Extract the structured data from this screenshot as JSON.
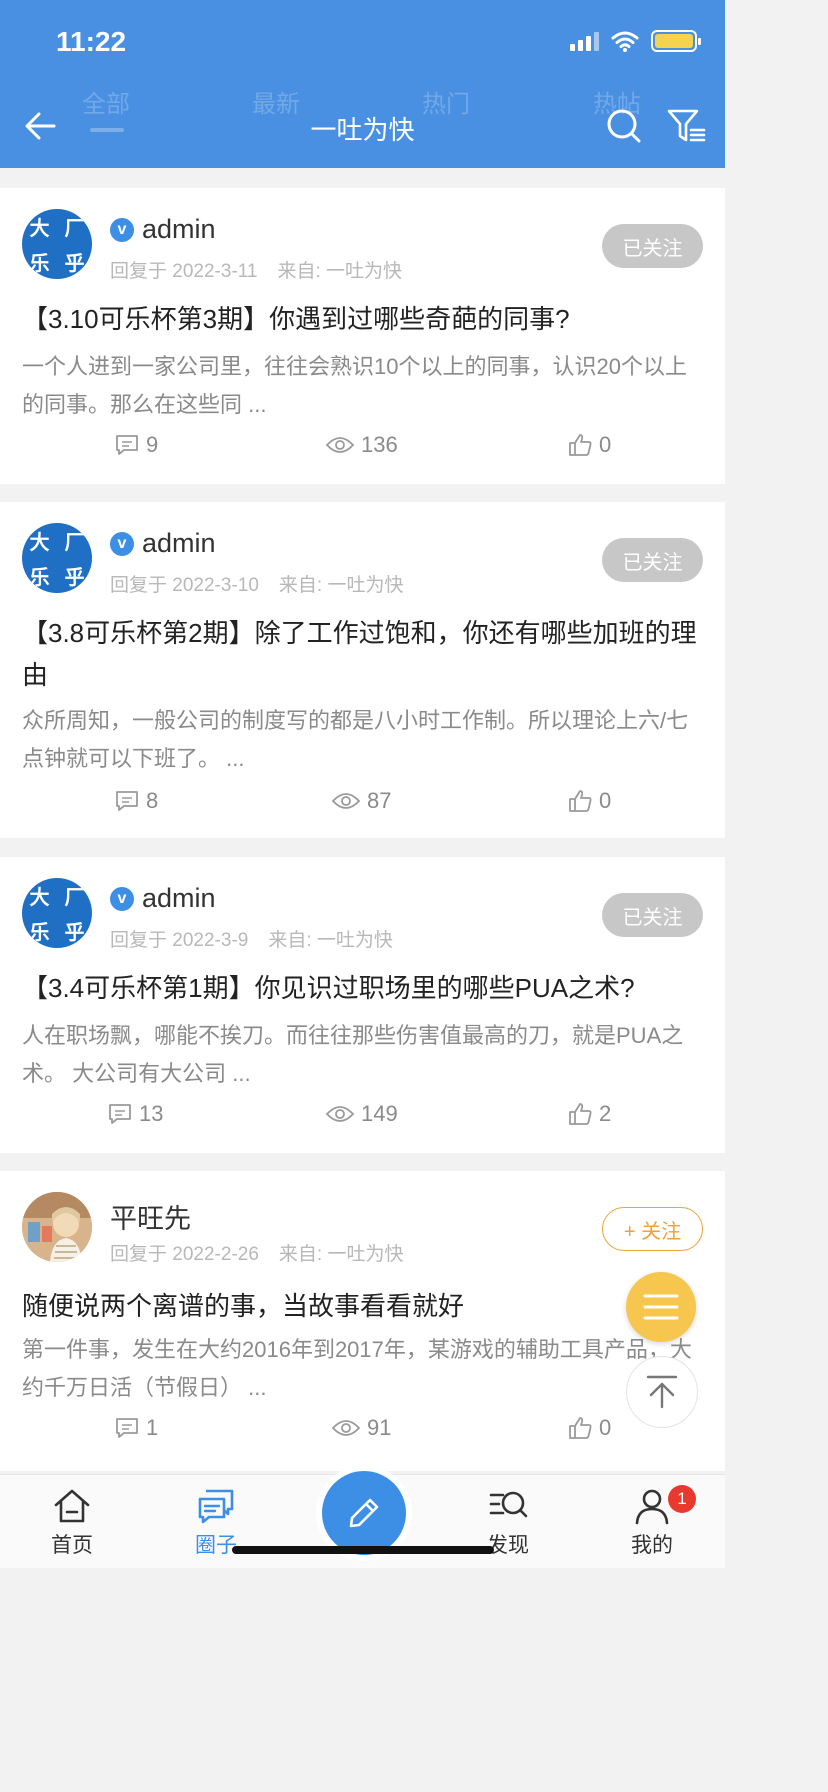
{
  "status_bar": {
    "time": "11:22"
  },
  "ghost_tabs": [
    "全部",
    "最新",
    "热门",
    "热帖"
  ],
  "nav": {
    "title": "一吐为快",
    "icons": [
      "back-arrow-icon",
      "search-icon",
      "filter-icon"
    ]
  },
  "posts": [
    {
      "author": "admin",
      "verified": true,
      "avatar_text": [
        "大",
        "厂",
        "乐",
        "乎"
      ],
      "meta_date": "回复于 2022-3-11",
      "meta_source": "来自: 一吐为快",
      "follow_label": "已关注",
      "title": "【3.10可乐杯第3期】你遇到过哪些奇葩的同事?",
      "excerpt": "一个人进到一家公司里，往往会熟识10个以上的同事，认识20个以上的同事。那么在这些同 ...",
      "comments": "9",
      "views": "136",
      "likes": "0"
    },
    {
      "author": "admin",
      "verified": true,
      "avatar_text": [
        "大",
        "厂",
        "乐",
        "乎"
      ],
      "meta_date": "回复于 2022-3-10",
      "meta_source": "来自: 一吐为快",
      "follow_label": "已关注",
      "title": "【3.8可乐杯第2期】除了工作过饱和，你还有哪些加班的理由",
      "excerpt": "众所周知，一般公司的制度写的都是八小时工作制。所以理论上六/七点钟就可以下班了。 ...",
      "comments": "8",
      "views": "87",
      "likes": "0"
    },
    {
      "author": "admin",
      "verified": true,
      "avatar_text": [
        "大",
        "厂",
        "乐",
        "乎"
      ],
      "meta_date": "回复于 2022-3-9",
      "meta_source": "来自: 一吐为快",
      "follow_label": "已关注",
      "title": "【3.4可乐杯第1期】你见识过职场里的哪些PUA之术?",
      "excerpt": "人在职场飘，哪能不挨刀。而往往那些伤害值最高的刀，就是PUA之术。 大公司有大公司 ...",
      "comments": "13",
      "views": "149",
      "likes": "2"
    },
    {
      "author": "平旺先",
      "verified": false,
      "meta_date": "回复于 2022-2-26",
      "meta_source": "来自: 一吐为快",
      "follow_label": "+ 关注",
      "title": "随便说两个离谱的事，当故事看看就好",
      "excerpt": "第一件事，发生在大约2016年到2017年，某游戏的辅助工具产品，大约千万日活（节假日） ...",
      "comments": "1",
      "views": "91",
      "likes": "0"
    }
  ],
  "tabbar": {
    "items": [
      {
        "label": "首页",
        "icon": "home-icon"
      },
      {
        "label": "圈子",
        "icon": "chat-bubbles-icon"
      },
      {
        "label": "发现",
        "icon": "discover-search-icon"
      },
      {
        "label": "我的",
        "icon": "person-icon"
      }
    ],
    "compose_icon": "pencil-icon",
    "profile_badge": "1"
  },
  "colors": {
    "brand_blue": "#4a90e2",
    "accent_orange": "#f0a23a",
    "fab_yellow": "#f6c64f",
    "badge_red": "#e8392f"
  }
}
